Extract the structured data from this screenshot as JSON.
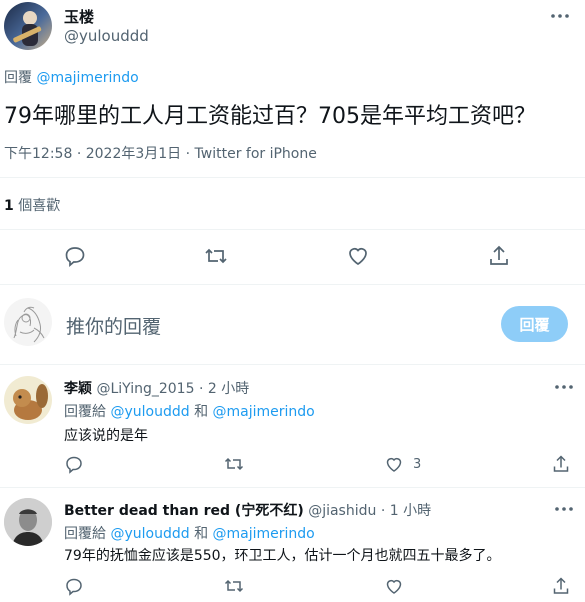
{
  "tweet": {
    "author_name": "玉楼",
    "author_handle": "@yulouddd",
    "reply_prefix": "回覆",
    "reply_to": "@majimerindo",
    "text": "79年哪里的工人月工资能过百？705是年平均工资吧？",
    "time": "下午12:58",
    "date": "2022年3月1日",
    "source": "Twitter for iPhone",
    "likes_count": "1",
    "likes_label": "個喜歡"
  },
  "compose": {
    "placeholder": "推你的回覆",
    "reply_button": "回覆"
  },
  "replies": [
    {
      "name": "李颖",
      "handle": "@LiYing_2015",
      "time": "2 小時",
      "reply_prefix": "回覆給",
      "reply_to_1": "@yulouddd",
      "and": "和",
      "reply_to_2": "@majimerindo",
      "text": "应该说的是年",
      "likes": "3"
    },
    {
      "name": "Better dead than red (宁死不红)",
      "handle": "@jiashidu",
      "time": "1 小時",
      "reply_prefix": "回覆給",
      "reply_to_1": "@yulouddd",
      "and": "和",
      "reply_to_2": "@majimerindo",
      "text": "79年的抚恤金应该是550，环卫工人，估计一个月也就四五十最多了。",
      "likes": ""
    }
  ],
  "colors": {
    "accent": "#1d9bf0",
    "muted": "#536471",
    "divider": "#eff3f4",
    "reply_button_disabled": "#8ecdf8"
  },
  "icons": [
    "more-icon",
    "reply-icon",
    "retweet-icon",
    "like-icon",
    "share-icon"
  ]
}
